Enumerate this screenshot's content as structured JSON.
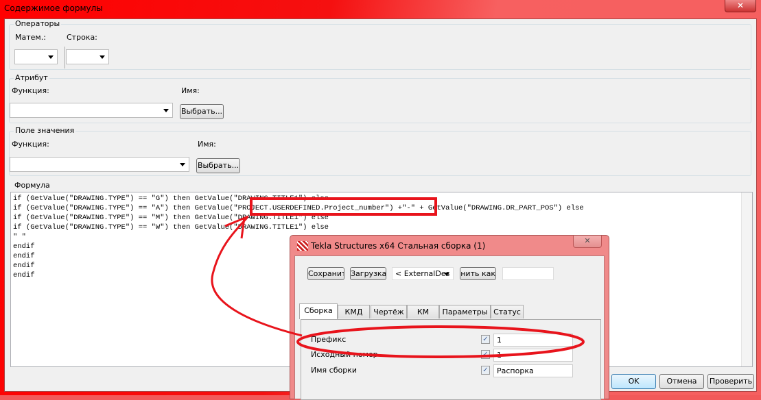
{
  "window": {
    "title": "Содержимое формулы",
    "close_icon": "close-icon"
  },
  "operators": {
    "legend": "Операторы",
    "math_label": "Матем.:",
    "string_label": "Строка:",
    "math_value": "",
    "string_value": ""
  },
  "attribute": {
    "legend": "Атрибут",
    "function_label": "Функция:",
    "name_label": "Имя:",
    "function_value": "",
    "select_label": "Выбрать..."
  },
  "value_field": {
    "legend": "Поле значения",
    "function_label": "Функция:",
    "name_label": "Имя:",
    "function_value": "",
    "select_label": "Выбрать..."
  },
  "formula": {
    "legend": "Формула",
    "lines": [
      "if (GetValue(\"DRAWING.TYPE\") == \"G\") then GetValue(\"DRAWING.TITLE1\") else",
      "if (GetValue(\"DRAWING.TYPE\") == \"A\") then GetValue(\"PROJECT.USERDEFINED.Project_number\") +\"-\" + GetValue(\"DRAWING.DR_PART_POS\") else",
      "if (GetValue(\"DRAWING.TYPE\") == \"M\") then GetValue(\"DRAWING.TITLE1\") else",
      "if (GetValue(\"DRAWING.TYPE\") == \"W\") then GetValue(\"DRAWING.TITLE1\") else",
      "\" \"",
      "endif",
      "endif",
      "endif",
      "endif"
    ]
  },
  "buttons": {
    "ok": "OK",
    "cancel": "Отмена",
    "check": "Проверить"
  },
  "dialog": {
    "title": "Tekla Structures x64  Стальная сборка (1)",
    "save": "Сохранить",
    "load": "Загрузка",
    "preset": "< ExternalDes",
    "save_as": "Сохранить как",
    "save_as_value": "",
    "tabs": [
      "Сборка",
      "КМД",
      "Чертёж",
      "КМ",
      "Параметры",
      "Статус"
    ],
    "rows": [
      {
        "label": "Префикс",
        "checked": true,
        "value": "1"
      },
      {
        "label": "Исходный номер",
        "checked": true,
        "value": "1"
      },
      {
        "label": "Имя сборки",
        "checked": true,
        "value": "Распорка"
      }
    ]
  },
  "annotation_color": "#e8141c"
}
